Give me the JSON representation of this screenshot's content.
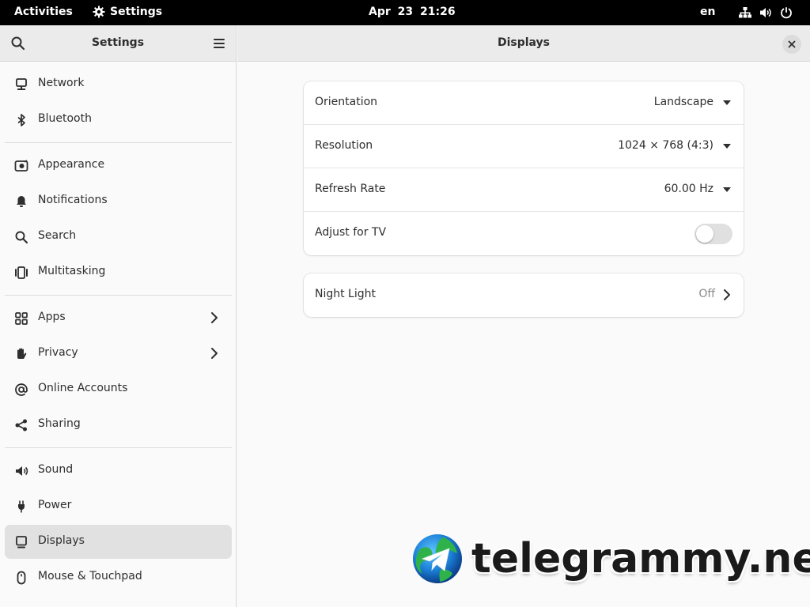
{
  "topbar": {
    "activities": "Activities",
    "app_name": "Settings",
    "date": "Apr 23",
    "time": "21:26",
    "language": "en",
    "tray_icons": [
      "network-wired-icon",
      "volume-icon",
      "power-icon"
    ]
  },
  "sidebar": {
    "title": "Settings",
    "items": [
      {
        "label": "Network",
        "icon": "network-icon"
      },
      {
        "label": "Bluetooth",
        "icon": "bluetooth-icon"
      },
      {
        "label": "Appearance",
        "icon": "appearance-icon"
      },
      {
        "label": "Notifications",
        "icon": "bell-icon"
      },
      {
        "label": "Search",
        "icon": "search-icon"
      },
      {
        "label": "Multitasking",
        "icon": "multitasking-icon"
      },
      {
        "label": "Apps",
        "icon": "apps-grid-icon",
        "has_submenu": true
      },
      {
        "label": "Privacy",
        "icon": "hand-icon",
        "has_submenu": true
      },
      {
        "label": "Online Accounts",
        "icon": "at-sign-icon"
      },
      {
        "label": "Sharing",
        "icon": "share-icon"
      },
      {
        "label": "Sound",
        "icon": "speaker-icon"
      },
      {
        "label": "Power",
        "icon": "power-plug-icon"
      },
      {
        "label": "Displays",
        "icon": "display-icon",
        "selected": true
      },
      {
        "label": "Mouse & Touchpad",
        "icon": "mouse-icon"
      }
    ]
  },
  "main": {
    "title": "Displays",
    "display_settings": {
      "orientation_label": "Orientation",
      "orientation_value": "Landscape",
      "resolution_label": "Resolution",
      "resolution_value": "1024 × 768 (4:3)",
      "refresh_label": "Refresh Rate",
      "refresh_value": "60.00 Hz",
      "tv_label": "Adjust for TV",
      "tv_enabled": false
    },
    "night_light": {
      "label": "Night Light",
      "value": "Off"
    }
  },
  "watermark": {
    "text": "telegrammy.net"
  },
  "colors": {
    "topbar": "#000000",
    "header": "#ebebeb",
    "selected": "#e1e1e1",
    "toggle_off": "#e0e0e0"
  }
}
